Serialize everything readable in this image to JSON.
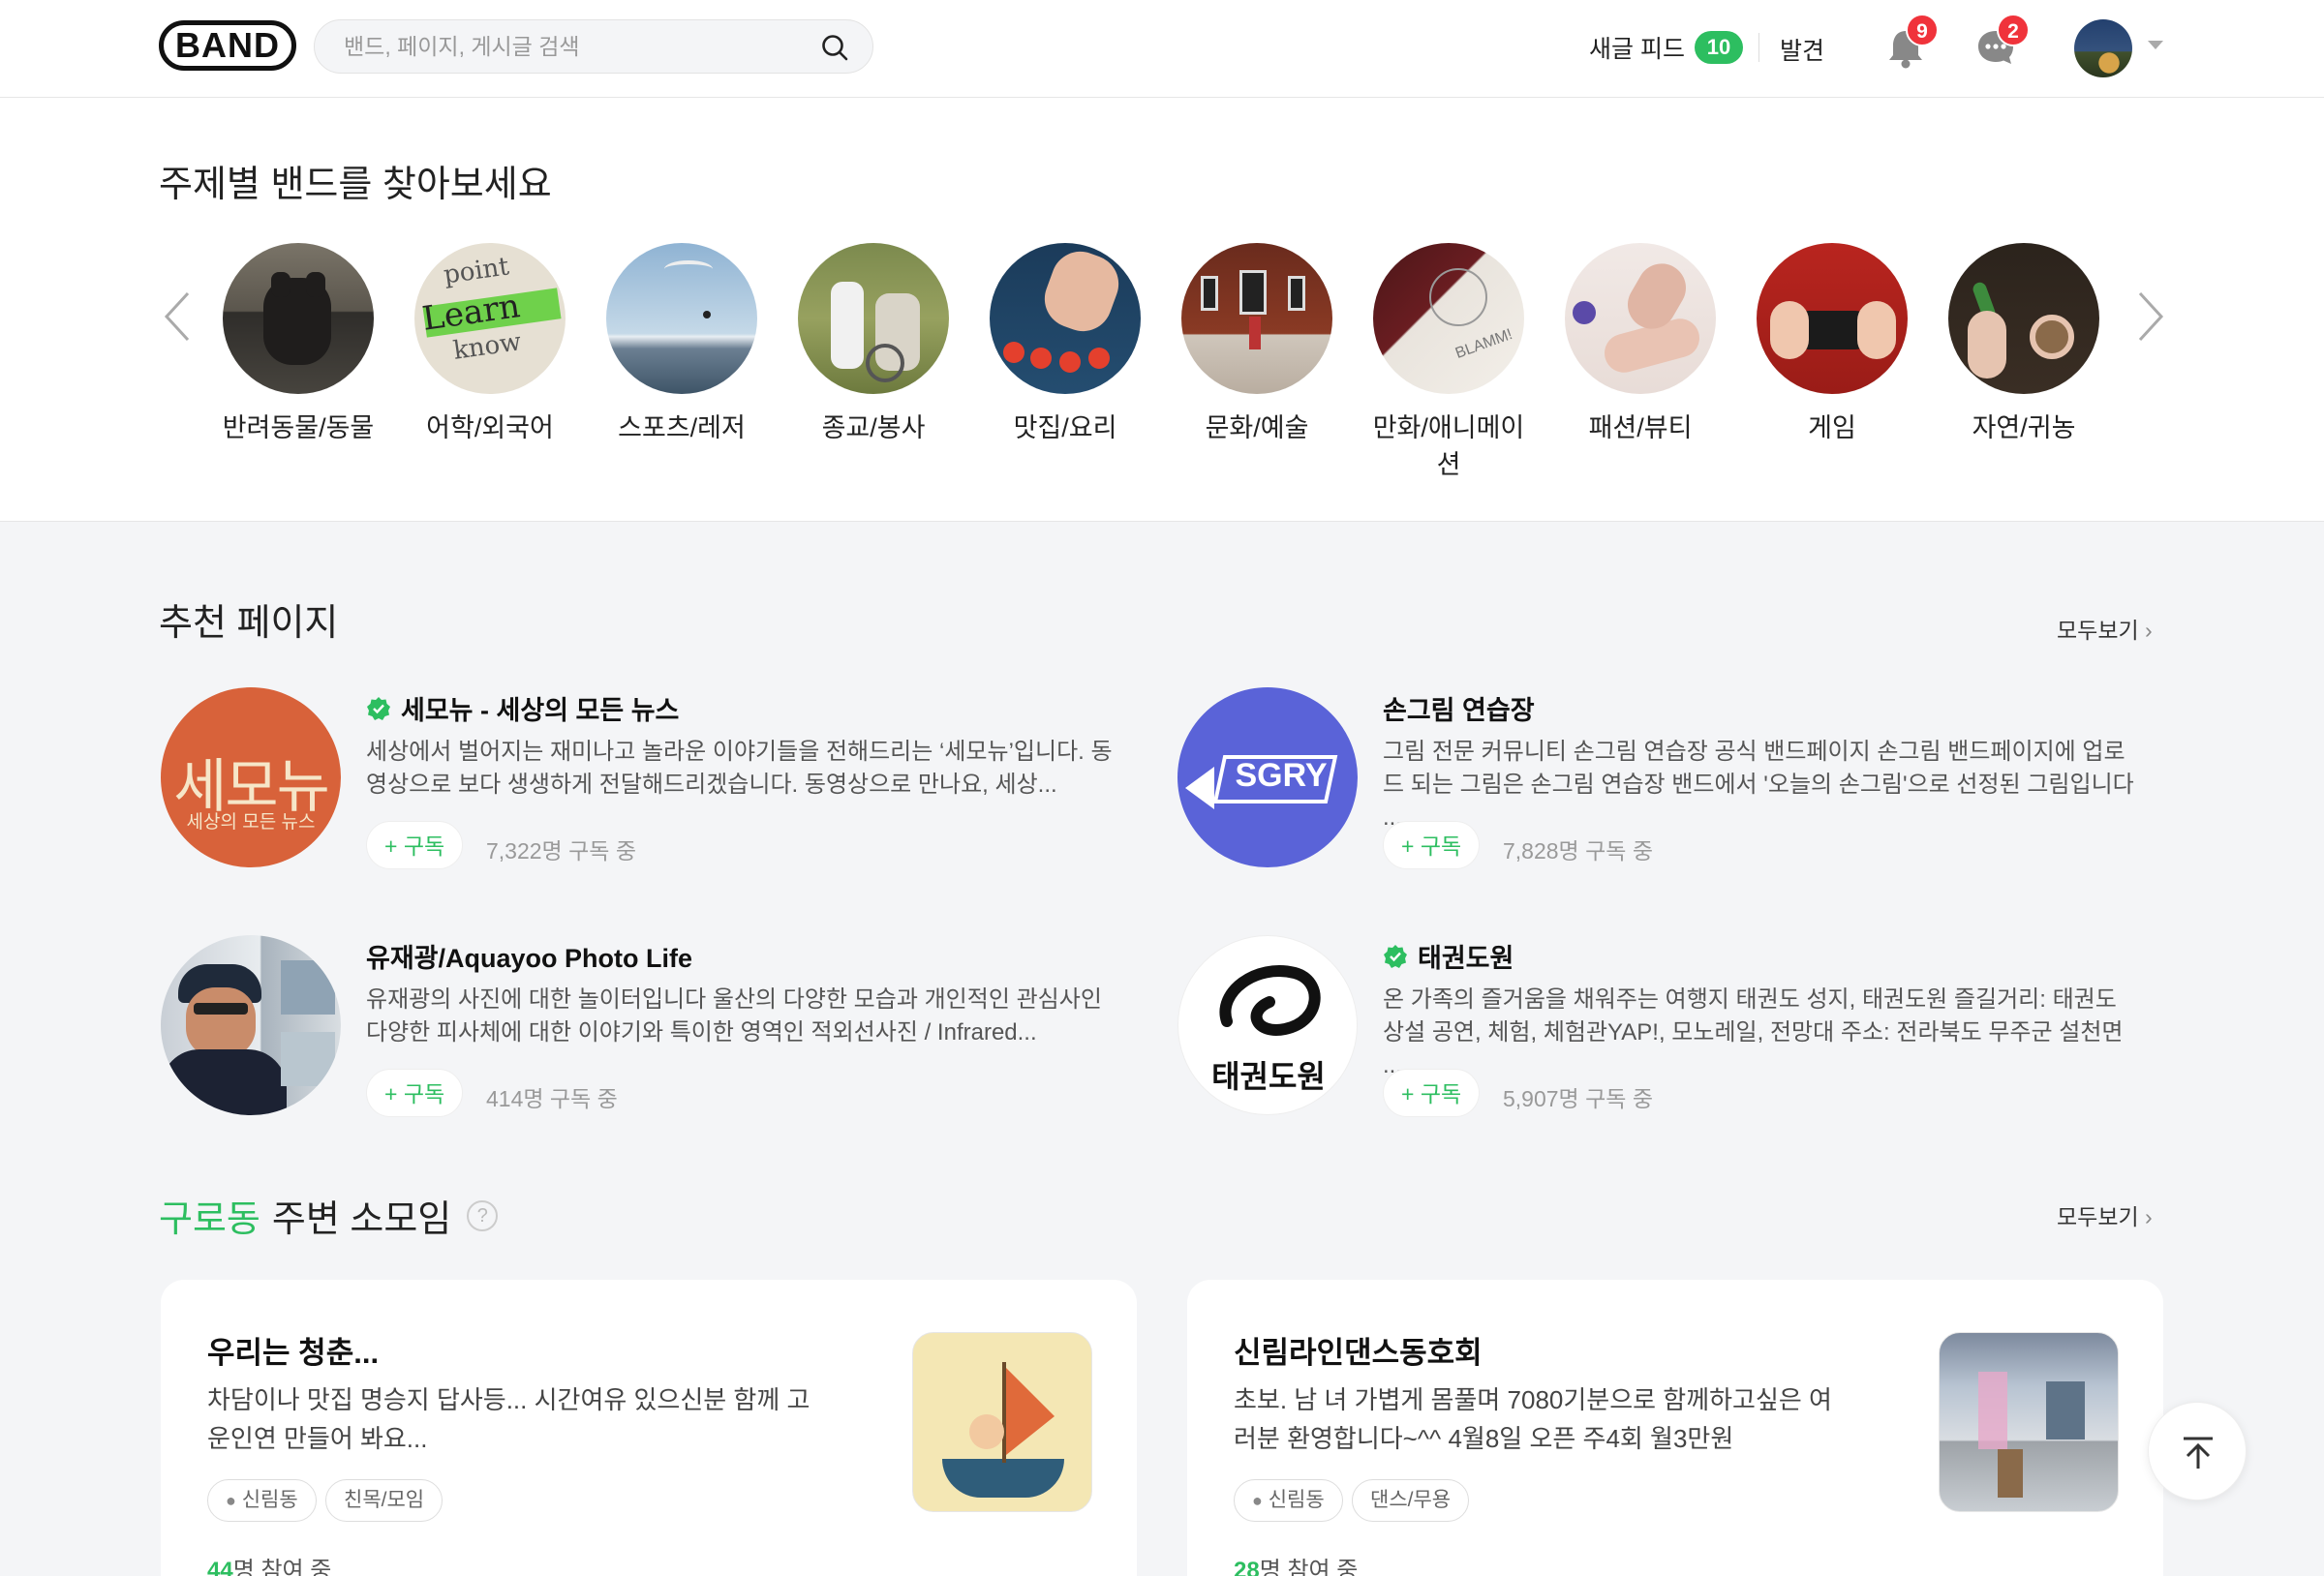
{
  "header": {
    "logo": "BAND",
    "search_placeholder": "밴드, 페이지, 게시글 검색",
    "feed_label": "새글 피드",
    "feed_count": "10",
    "discover_label": "발견",
    "notification_count": "9",
    "chat_count": "2"
  },
  "topics": {
    "title": "주제별 밴드를 찾아보세요",
    "items": [
      {
        "label": "반려동물/동물"
      },
      {
        "label": "어학/외국어"
      },
      {
        "label": "스포츠/레저"
      },
      {
        "label": "종교/봉사"
      },
      {
        "label": "맛집/요리"
      },
      {
        "label": "문화/예술"
      },
      {
        "label": "만화/애니메이션"
      },
      {
        "label": "패션/뷰티"
      },
      {
        "label": "게임"
      },
      {
        "label": "자연/귀농"
      }
    ]
  },
  "recommended": {
    "title": "추천 페이지",
    "more_label": "모두보기",
    "pages": [
      {
        "name": "세모뉴 - 세상의 모든 뉴스",
        "desc": "세상에서 벌어지는 재미나고 놀라운 이야기들을 전해드리는 ‘세모뉴’입니다. 동영상으로 보다 생생하게 전달해드리겠습니다. 동영상으로 만나요, 세상...",
        "subscribe": "+ 구독",
        "count": "7,322명 구독 중",
        "thumb_text": "세모뉴",
        "thumb_sub": "세상의 모든 뉴스"
      },
      {
        "name": "손그림 연습장",
        "desc": "그림 전문 커뮤니티 손그림 연습장 공식 밴드페이지 손그림 밴드페이지에 업로드 되는 그림은 손그림 연습장 밴드에서 '오늘의 손그림'으로 선정된 그림입니다 ...",
        "subscribe": "+ 구독",
        "count": "7,828명 구독 중",
        "thumb_text": "SGRY"
      },
      {
        "name": "유재광/Aquayoo Photo Life",
        "desc": "유재광의 사진에 대한 놀이터입니다 울산의 다양한 모습과 개인적인 관심사인 다양한 피사체에 대한 이야기와 특이한 영역인 적외선사진 / Infrared...",
        "subscribe": "+ 구독",
        "count": "414명 구독 중"
      },
      {
        "name": "태권도원",
        "desc": "온 가족의 즐거움을 채워주는 여행지 태권도 성지, 태권도원 즐길거리: 태권도 상설 공연, 체험, 체험관YAP!, 모노레일, 전망대 주소: 전라북도 무주군 설천면 ...",
        "subscribe": "+ 구독",
        "count": "5,907명 구독 중",
        "thumb_text": "태권도원"
      }
    ]
  },
  "nearby": {
    "location": "구로동",
    "title": "주변 소모임",
    "help": "?",
    "more_label": "모두보기",
    "cards": [
      {
        "title": "우리는 청춘...",
        "desc": "차담이나 맛집 명승지 답사등... 시간여유 있으신분 함께 고운인연 만들어 봐요...",
        "chips": [
          "신림동",
          "친목/모임"
        ],
        "count_num": "44",
        "count_text": "명 참여 중"
      },
      {
        "title": "신림라인댄스동호회",
        "desc": "초보. 남 녀 가볍게 몸풀며 7080기분으로 함께하고싶은 여러분 환영합니다~^^ 4월8일 오픈 주4회 월3만원",
        "chips": [
          "신림동",
          "댄스/무용"
        ],
        "count_num": "28",
        "count_text": "명 참여 중"
      }
    ]
  },
  "colors": {
    "accent": "#2dbe60",
    "badge": "#f0333b",
    "background": "#f4f5f7"
  }
}
